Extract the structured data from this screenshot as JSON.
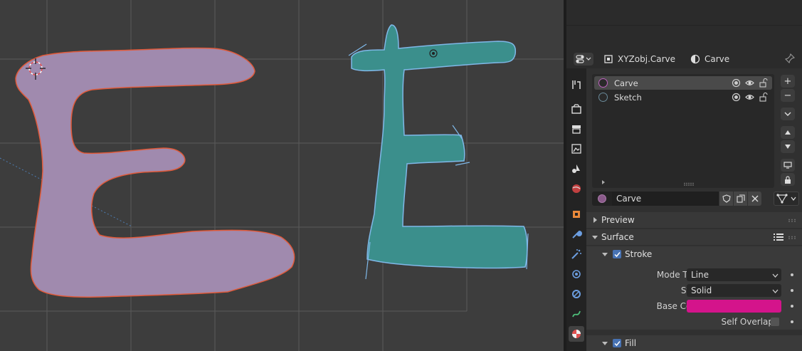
{
  "header": {
    "object_label": "XYZobj.Carve",
    "material_label": "Carve"
  },
  "layers": [
    {
      "name": "Carve",
      "selected": true
    },
    {
      "name": "Sketch",
      "selected": false
    }
  ],
  "material_slot": {
    "name": "Carve"
  },
  "panels": {
    "preview": "Preview",
    "surface": "Surface",
    "stroke": "Stroke",
    "fill": "Fill"
  },
  "stroke_props": {
    "mode_type_label": "Mode Type",
    "mode_type_value": "Line",
    "style_label": "Style",
    "style_value": "Solid",
    "base_color_label": "Base Color",
    "base_color": "#d4148b",
    "self_overlap_label": "Self Overlap"
  },
  "side_buttons": {
    "add": "+",
    "remove": "−"
  },
  "colors": {
    "accent": "#4772b3",
    "pink_fill": "#a08aae",
    "pink_outline": "#e05a3a",
    "teal_fill": "#3b8f8c",
    "teal_outline": "#7fb8e8"
  },
  "tabs": [
    "tool-icon",
    "render-icon",
    "output-icon",
    "view-layer-icon",
    "scene-icon",
    "world-icon",
    "object-icon",
    "modifier-icon",
    "effects-icon",
    "physics-icon",
    "constraints-icon",
    "data-icon",
    "material-icon"
  ]
}
